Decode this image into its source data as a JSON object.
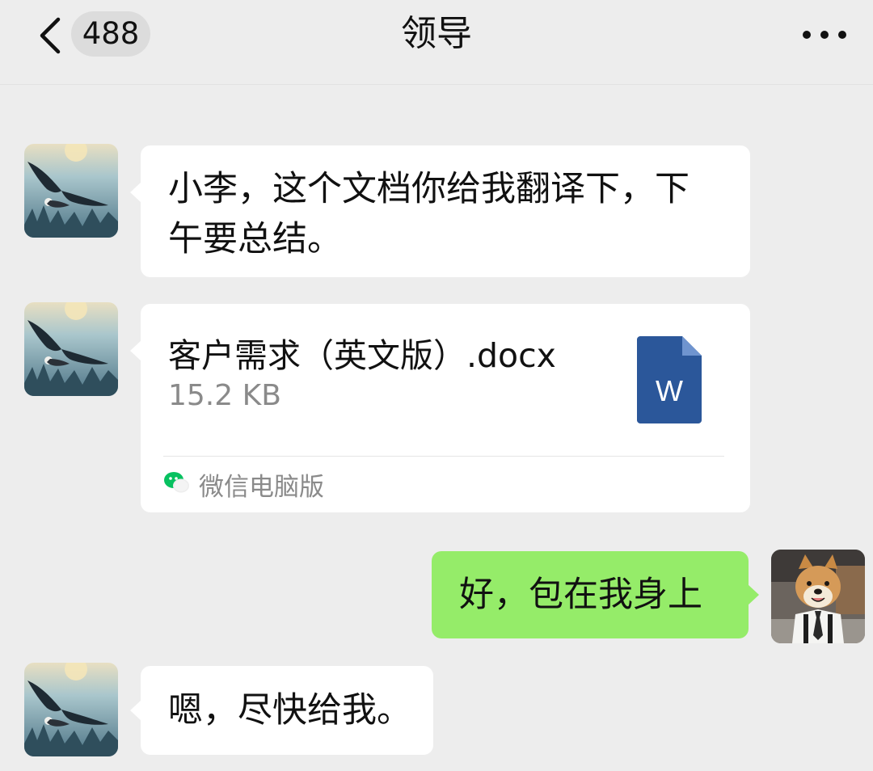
{
  "header": {
    "unread_count": "488",
    "title": "领导",
    "back_icon": "chevron-left-icon",
    "more_icon": "ellipsis-icon"
  },
  "messages": [
    {
      "sender": "contact",
      "type": "text",
      "line1": "小李，这个文档你给我翻译下，下",
      "line2": "午要总结。"
    },
    {
      "sender": "contact",
      "type": "file",
      "file_name": "客户需求（英文版）.docx",
      "file_size": "15.2 KB",
      "file_icon": "word-document-icon",
      "file_icon_letter": "W",
      "source_label": "微信电脑版",
      "source_icon": "wechat-icon"
    },
    {
      "sender": "me",
      "type": "text",
      "text": "好，包在我身上"
    },
    {
      "sender": "contact",
      "type": "text",
      "text": "嗯，尽快给我。"
    }
  ],
  "colors": {
    "background": "#ededed",
    "incoming_bubble": "#ffffff",
    "outgoing_bubble": "#95ec69",
    "word_blue": "#2b579a",
    "wechat_green": "#07c160"
  }
}
